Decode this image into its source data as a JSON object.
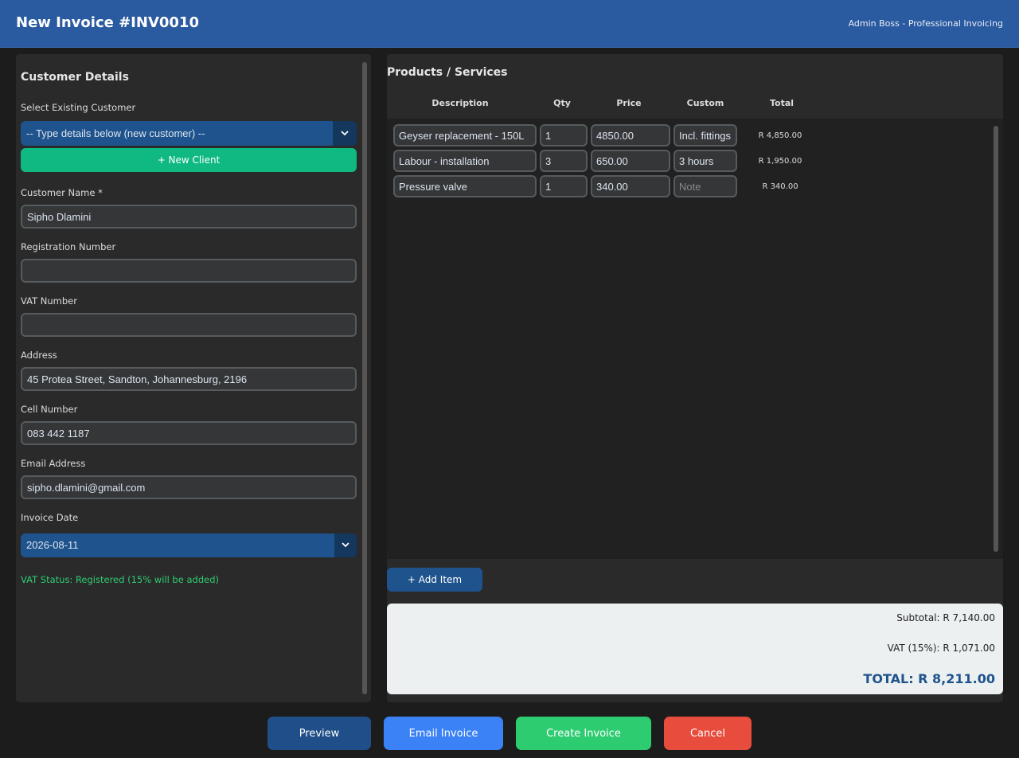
{
  "header": {
    "title": "New Invoice #INV0010",
    "subtitle": "Admin Boss - Professional Invoicing"
  },
  "customer": {
    "section_title": "Customer Details",
    "select_label": "Select Existing Customer",
    "select_value": "-- Type details below (new customer) --",
    "new_client_label": "+ New Client",
    "name_label": "Customer Name *",
    "name_value": "Sipho Dlamini",
    "reg_label": "Registration Number",
    "reg_value": "",
    "vat_label": "VAT Number",
    "vat_value": "",
    "address_label": "Address",
    "address_value": "45 Protea Street, Sandton, Johannesburg, 2196",
    "cell_label": "Cell Number",
    "cell_value": "083 442 1187",
    "email_label": "Email Address",
    "email_value": "sipho.dlamini@gmail.com",
    "date_label": "Invoice Date",
    "date_value": "2026-08-11",
    "vat_status": "VAT Status: Registered (15% will be added)"
  },
  "products": {
    "title": "Products / Services",
    "columns": {
      "description": "Description",
      "qty": "Qty",
      "price": "Price",
      "custom": "Custom",
      "total": "Total"
    },
    "items": [
      {
        "description": "Geyser replacement - 150L",
        "qty": "1",
        "price": "4850.00",
        "custom": "Incl. fittings",
        "custom_placeholder": "Note",
        "total": "R 4,850.00"
      },
      {
        "description": "Labour - installation",
        "qty": "3",
        "price": "650.00",
        "custom": "3 hours",
        "custom_placeholder": "Note",
        "total": "R 1,950.00"
      },
      {
        "description": "Pressure valve",
        "qty": "1",
        "price": "340.00",
        "custom": "",
        "custom_placeholder": "Note",
        "total": "R 340.00"
      }
    ],
    "add_item_label": "+ Add Item"
  },
  "totals": {
    "subtotal": "Subtotal: R 7,140.00",
    "vat": "VAT (15%): R 1,071.00",
    "total": "TOTAL: R 8,211.00"
  },
  "actions": {
    "preview": "Preview",
    "email": "Email Invoice",
    "create": "Create Invoice",
    "cancel": "Cancel"
  },
  "colors": {
    "header_bg": "#2a5aa0",
    "new_client": "#10b981",
    "preview": "#1f4e89",
    "email": "#3b82f6",
    "create": "#2ecc71",
    "cancel": "#e74c3c",
    "vat_status": "#2ecc71",
    "total_text": "#1f538d"
  },
  "icons": {
    "dropdown_arrow": "chevron-down-icon"
  }
}
